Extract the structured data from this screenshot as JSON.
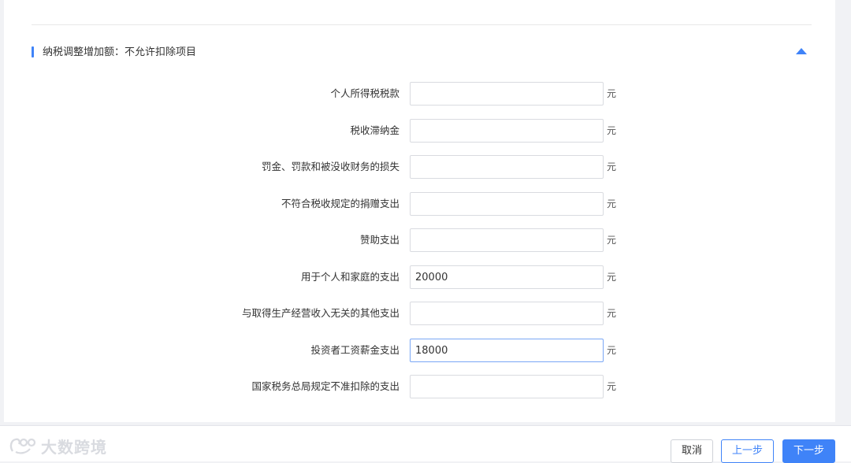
{
  "section": {
    "title": "纳税调整增加额：不允许扣除项目"
  },
  "form": {
    "unit": "元",
    "rows": [
      {
        "label": "个人所得税税款",
        "value": ""
      },
      {
        "label": "税收滞纳金",
        "value": ""
      },
      {
        "label": "罚金、罚款和被没收财务的损失",
        "value": ""
      },
      {
        "label": "不符合税收规定的捐赠支出",
        "value": ""
      },
      {
        "label": "赞助支出",
        "value": ""
      },
      {
        "label": "用于个人和家庭的支出",
        "value": "20000"
      },
      {
        "label": "与取得生产经营收入无关的其他支出",
        "value": ""
      },
      {
        "label": "投资者工资薪金支出",
        "value": "18000"
      },
      {
        "label": "国家税务总局规定不准扣除的支出",
        "value": ""
      }
    ]
  },
  "footer": {
    "watermark": "大数跨境",
    "cancel_label": "取消",
    "prev_label": "上一步",
    "next_label": "下一步"
  },
  "colors": {
    "accent": "#3f83f8",
    "background": "#f1f2f5"
  }
}
